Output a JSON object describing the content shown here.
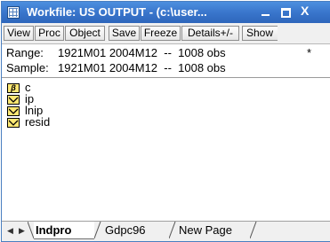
{
  "window": {
    "title": "Workfile: US OUTPUT - (c:\\user...",
    "controls": {
      "minimize": "_",
      "maximize": "□",
      "close": "X"
    }
  },
  "toolbar": {
    "buttons": [
      "View",
      "Proc",
      "Object",
      "Save",
      "Freeze",
      "Details+/-",
      "Show"
    ]
  },
  "info": {
    "range_label": "Range:",
    "range_value": "1921M01 2004M12  --  1008 obs",
    "sample_label": "Sample:",
    "sample_value": "1921M01 2004M12  --  1008 obs",
    "modified_marker": "*"
  },
  "objects": [
    {
      "name": "c",
      "icon": "coefficient-vector-icon"
    },
    {
      "name": "ip",
      "icon": "series-icon"
    },
    {
      "name": "lnip",
      "icon": "series-icon"
    },
    {
      "name": "resid",
      "icon": "series-icon"
    }
  ],
  "tabs": {
    "items": [
      "Indpro",
      "Gdpc96",
      "New Page"
    ],
    "active": "Indpro"
  },
  "colors": {
    "titlebar": "#3a76cc",
    "series_icon": "#ffe873"
  }
}
